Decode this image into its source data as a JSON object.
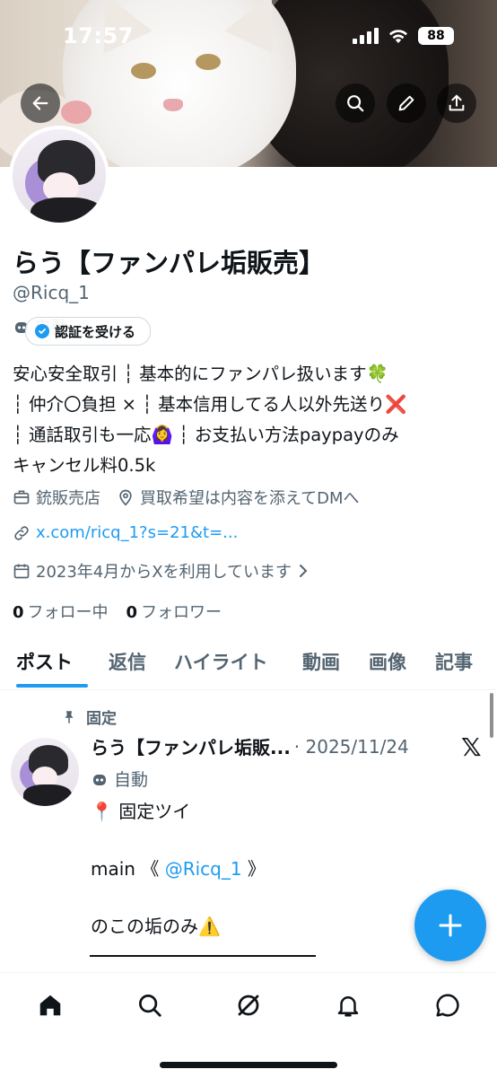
{
  "status_bar": {
    "time": "17:57",
    "battery": "88"
  },
  "profile": {
    "name": "らう【ファンパレ垢販売】",
    "handle": "@Ricq_1",
    "auto_label": "自動",
    "verify_button": "認証を受ける",
    "bio_lines": [
      "安心安全取引 ┆ 基本的にファンパレ扱います🍀",
      "┆ 仲介〇負担 × ┆ 基本信用してる人以外先送り❌",
      "┆ 通話取引も一応🙆‍♀️ ┆ お支払い方法paypayのみ",
      "キャンセル料0.5k"
    ],
    "category": "銃販売店",
    "location": "買取希望は内容を添えてDMへ",
    "link": "x.com/ricq_1?s=21&t=...",
    "joined": "2023年4月からXを利用しています",
    "following_count": "0",
    "following_label": "フォロー中",
    "followers_count": "0",
    "followers_label": "フォロワー"
  },
  "tabs": [
    "ポスト",
    "返信",
    "ハイライト",
    "動画",
    "画像",
    "記事"
  ],
  "active_tab": "ポスト",
  "pinned_post": {
    "pinned_label": "固定",
    "author": "らう【ファンパレ垢販...",
    "date": "· 2025/11/24",
    "auto_label": "自動",
    "line1": "📍 固定ツイ",
    "line2_prefix": "main 《 ",
    "mention": "@Ricq_1",
    "line2_suffix": " 》",
    "line3": "のこの垢のみ⚠️"
  },
  "icons": {
    "back": "arrow-left-icon",
    "search": "search-icon",
    "edit": "pencil-icon",
    "share": "share-icon",
    "fab": "plus-icon",
    "nav": [
      "home-icon",
      "search-icon",
      "grok-icon",
      "bell-icon",
      "message-icon"
    ]
  },
  "colors": {
    "accent": "#1d9bf0",
    "text": "#0f1419",
    "muted": "#536471"
  }
}
